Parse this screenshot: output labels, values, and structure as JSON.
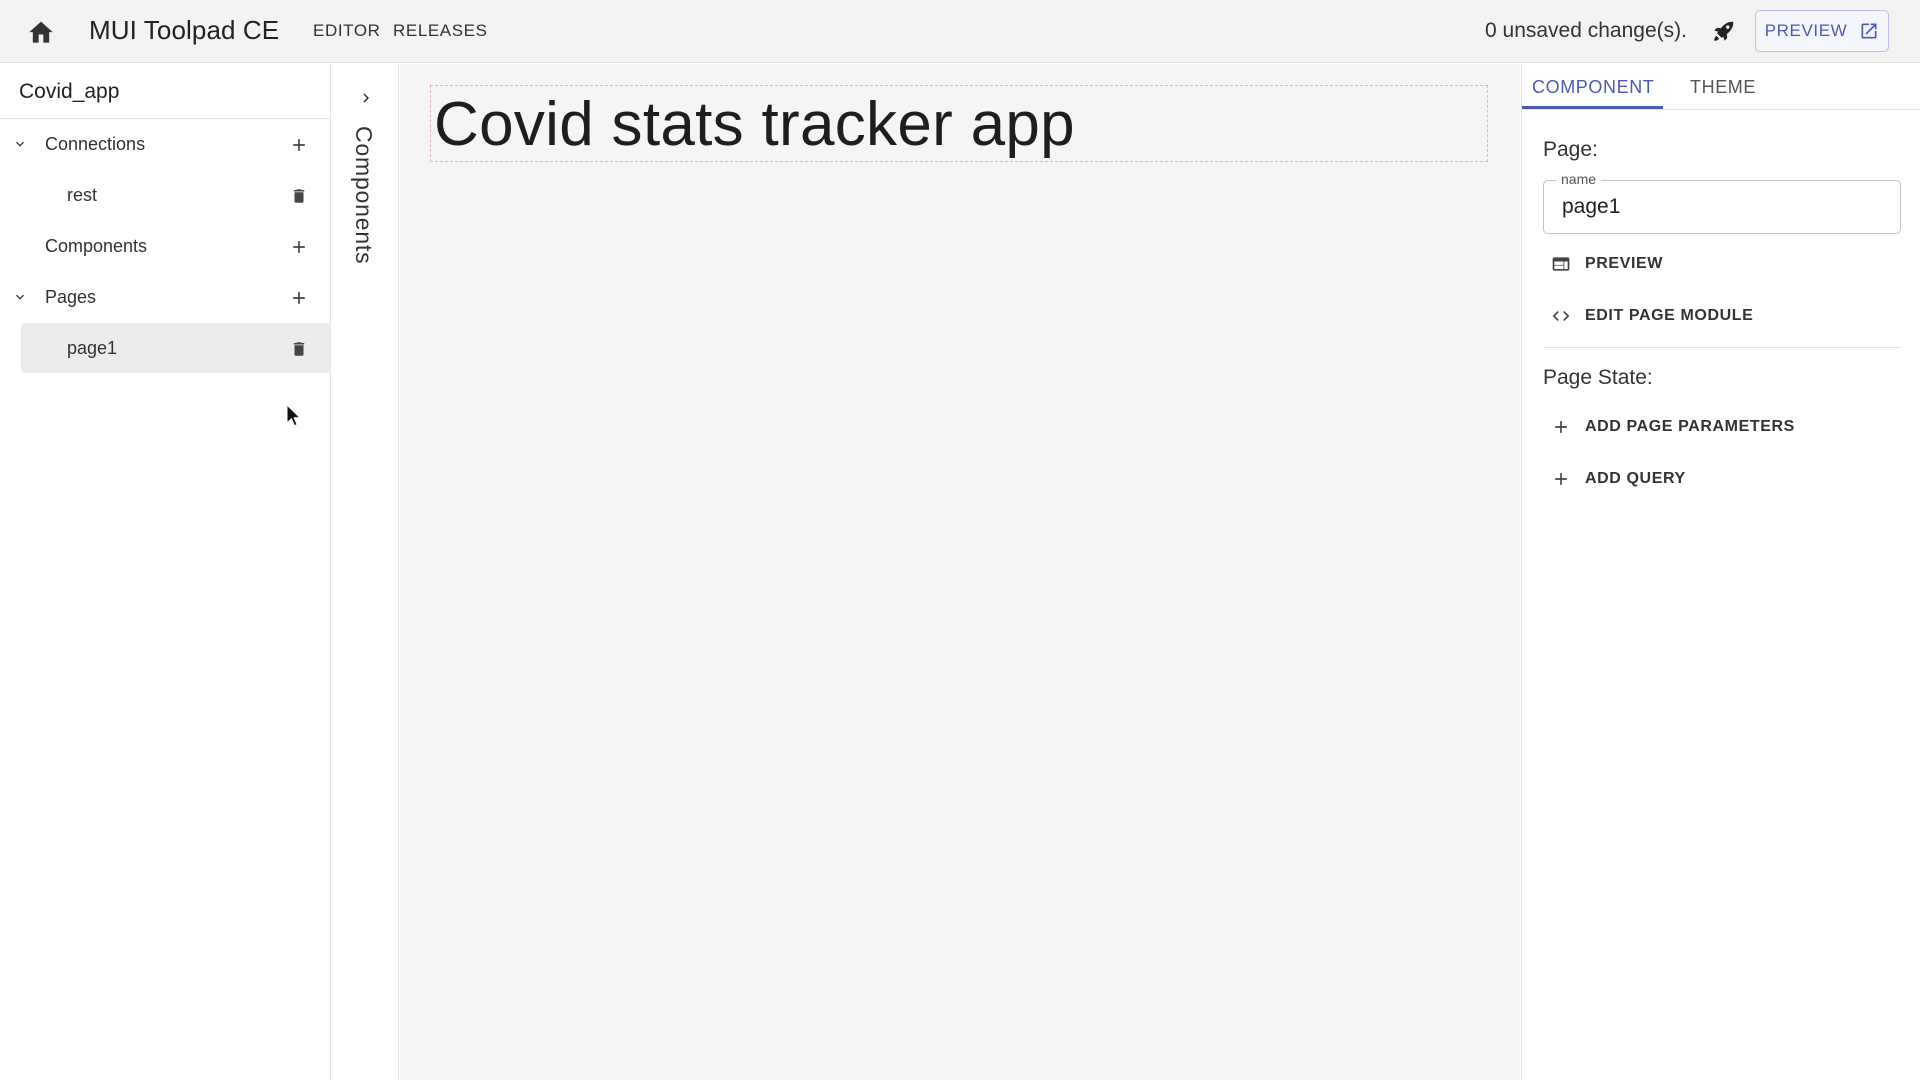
{
  "topbar": {
    "app_title": "MUI Toolpad CE",
    "nav": {
      "editor": "EDITOR",
      "releases": "RELEASES"
    },
    "unsaved_status": "0 unsaved change(s).",
    "preview_label": "PREVIEW",
    "icons": {
      "home": "home-icon",
      "deploy": "rocket-icon",
      "preview": "open-in-new-icon"
    }
  },
  "explorer": {
    "app_name": "Covid_app",
    "sections": [
      {
        "label": "Connections",
        "expanded": true,
        "children": [
          {
            "label": "rest"
          }
        ]
      },
      {
        "label": "Components",
        "expanded": false,
        "children": []
      },
      {
        "label": "Pages",
        "expanded": true,
        "children": [
          {
            "label": "page1",
            "selected": true
          }
        ]
      }
    ]
  },
  "components_rail": {
    "label": "Components"
  },
  "canvas": {
    "title": "Covid stats tracker app"
  },
  "inspector": {
    "tabs": [
      {
        "label": "COMPONENT",
        "active": true
      },
      {
        "label": "THEME",
        "active": false
      }
    ],
    "page_label": "Page:",
    "name_field": {
      "legend": "name",
      "value": "page1"
    },
    "preview_button": "PREVIEW",
    "edit_module_button": "EDIT PAGE MODULE",
    "page_state_label": "Page State:",
    "add_params_button": "ADD PAGE PARAMETERS",
    "add_query_button": "ADD QUERY"
  },
  "colors": {
    "accent": "#4a5bb3",
    "topbar_bg": "#f3f3f3",
    "canvas_bg": "#f5f5f5",
    "selected_row_bg": "#ececef"
  }
}
